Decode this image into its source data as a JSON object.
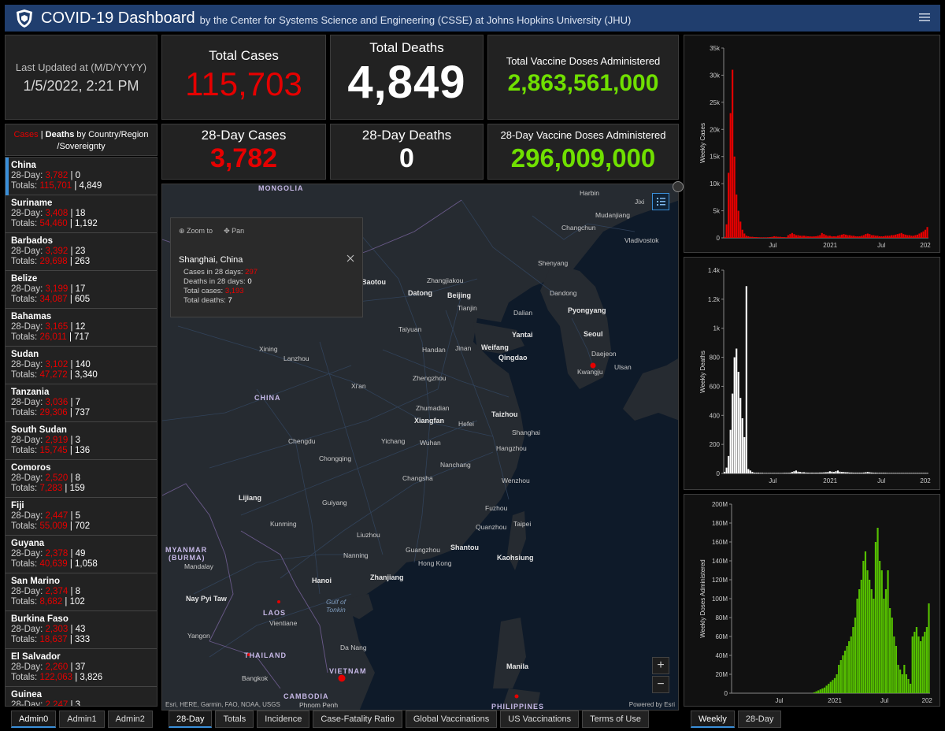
{
  "header": {
    "title": "COVID-19 Dashboard",
    "subtitle": "by the Center for Systems Science and Engineering (CSSE) at Johns Hopkins University (JHU)"
  },
  "updated": {
    "label": "Last Updated at (M/D/YYYY)",
    "value": "1/5/2022, 2:21 PM"
  },
  "stats": {
    "total_cases_label": "Total Cases",
    "total_cases": "115,703",
    "total_deaths_label": "Total Deaths",
    "total_deaths": "4,849",
    "total_vacc_label": "Total Vaccine Doses Administered",
    "total_vacc": "2,863,561,000",
    "cases28_label": "28-Day Cases",
    "cases28": "3,782",
    "deaths28_label": "28-Day Deaths",
    "deaths28": "0",
    "vacc28_label": "28-Day Vaccine Doses Administered",
    "vacc28": "296,009,000"
  },
  "list_header": {
    "cases": "Cases",
    "sep": " | ",
    "deaths": "Deaths",
    "rest": " by Country/Region /Sovereignty"
  },
  "countries": [
    {
      "name": "China",
      "d28c": "3,782",
      "d28d": "0",
      "tc": "115,701",
      "td": "4,849"
    },
    {
      "name": "Suriname",
      "d28c": "3,408",
      "d28d": "18",
      "tc": "54,460",
      "td": "1,192"
    },
    {
      "name": "Barbados",
      "d28c": "3,392",
      "d28d": "23",
      "tc": "29,698",
      "td": "263"
    },
    {
      "name": "Belize",
      "d28c": "3,199",
      "d28d": "17",
      "tc": "34,087",
      "td": "605"
    },
    {
      "name": "Bahamas",
      "d28c": "3,165",
      "d28d": "12",
      "tc": "26,011",
      "td": "717"
    },
    {
      "name": "Sudan",
      "d28c": "3,102",
      "d28d": "140",
      "tc": "47,272",
      "td": "3,340"
    },
    {
      "name": "Tanzania",
      "d28c": "3,036",
      "d28d": "7",
      "tc": "29,306",
      "td": "737"
    },
    {
      "name": "South Sudan",
      "d28c": "2,919",
      "d28d": "3",
      "tc": "15,745",
      "td": "136"
    },
    {
      "name": "Comoros",
      "d28c": "2,520",
      "d28d": "8",
      "tc": "7,283",
      "td": "159"
    },
    {
      "name": "Fiji",
      "d28c": "2,447",
      "d28d": "5",
      "tc": "55,009",
      "td": "702"
    },
    {
      "name": "Guyana",
      "d28c": "2,378",
      "d28d": "49",
      "tc": "40,639",
      "td": "1,058"
    },
    {
      "name": "San Marino",
      "d28c": "2,374",
      "d28d": "8",
      "tc": "8,682",
      "td": "102"
    },
    {
      "name": "Burkina Faso",
      "d28c": "2,303",
      "d28d": "43",
      "tc": "18,637",
      "td": "333"
    },
    {
      "name": "El Salvador",
      "d28c": "2,260",
      "d28d": "37",
      "tc": "122,063",
      "td": "3,826"
    },
    {
      "name": "Guinea",
      "d28c": "2,247",
      "d28d": "3",
      "tc": "",
      "td": ""
    }
  ],
  "list_labels": {
    "d28": "28-Day: ",
    "totals": "Totals: "
  },
  "popup": {
    "zoom": "Zoom to",
    "pan": "Pan",
    "title": "Shanghai, China",
    "cases28_label": "Cases in 28 days: ",
    "cases28": "297",
    "deaths28_label": "Deaths in 28 days: ",
    "deaths28": "0",
    "total_cases_label": "Total cases: ",
    "total_cases": "3,193",
    "total_deaths_label": "Total deaths: ",
    "total_deaths": "7"
  },
  "map": {
    "attribution": "Esri, HERE, Garmin, FAO, NOAA, USGS",
    "powered": "Powered by Esri",
    "countries": [
      {
        "t": "MONGOLIA"
      },
      {
        "t": "CHINA"
      },
      {
        "t": "MYANMAR"
      },
      {
        "t": "(BURMA)"
      },
      {
        "t": "LAOS"
      },
      {
        "t": "THAILAND"
      },
      {
        "t": "VIETNAM"
      },
      {
        "t": "CAMBODIA"
      },
      {
        "t": "PHILIPPINES"
      }
    ],
    "seas": [
      {
        "t": "Gulf of"
      },
      {
        "t": "Tonkin"
      }
    ],
    "cities": [
      {
        "t": "Harbin"
      },
      {
        "t": "Jixi"
      },
      {
        "t": "Mudanjiang"
      },
      {
        "t": "Changchun"
      },
      {
        "t": "Vladivostok"
      },
      {
        "t": "Shenyang"
      },
      {
        "t": "Baotou"
      },
      {
        "t": "Zhangjiakou"
      },
      {
        "t": "Datong"
      },
      {
        "t": "Beijing"
      },
      {
        "t": "Tianjin"
      },
      {
        "t": "Dandong"
      },
      {
        "t": "Pyongyang"
      },
      {
        "t": "Dalian"
      },
      {
        "t": "Taiyuan"
      },
      {
        "t": "Yantai"
      },
      {
        "t": "Seoul"
      },
      {
        "t": "Xining"
      },
      {
        "t": "Lanzhou"
      },
      {
        "t": "Handan"
      },
      {
        "t": "Jinan"
      },
      {
        "t": "Weifang"
      },
      {
        "t": "Qingdao"
      },
      {
        "t": "Daejeon"
      },
      {
        "t": "Ulsan"
      },
      {
        "t": "Kwangju"
      },
      {
        "t": "Xi'an"
      },
      {
        "t": "Zhengzhou"
      },
      {
        "t": "Zhumadian"
      },
      {
        "t": "Taizhou"
      },
      {
        "t": "Xiangfan"
      },
      {
        "t": "Hefei"
      },
      {
        "t": "Shanghai"
      },
      {
        "t": "Chengdu"
      },
      {
        "t": "Yichang"
      },
      {
        "t": "Wuhan"
      },
      {
        "t": "Hangzhou"
      },
      {
        "t": "Chongqing"
      },
      {
        "t": "Changsha"
      },
      {
        "t": "Nanchang"
      },
      {
        "t": "Wenzhou"
      },
      {
        "t": "Lijiang"
      },
      {
        "t": "Guiyang"
      },
      {
        "t": "Fuzhou"
      },
      {
        "t": "Kunming"
      },
      {
        "t": "Liuzhou"
      },
      {
        "t": "Quanzhou"
      },
      {
        "t": "Taipei"
      },
      {
        "t": "Mandalay"
      },
      {
        "t": "Nanning"
      },
      {
        "t": "Guangzhou"
      },
      {
        "t": "Shantou"
      },
      {
        "t": "Hong Kong"
      },
      {
        "t": "Kaohsiung"
      },
      {
        "t": "Hanoi"
      },
      {
        "t": "Zhanjiang"
      },
      {
        "t": "Nay Pyi Taw"
      },
      {
        "t": "Vientiane"
      },
      {
        "t": "Yangon"
      },
      {
        "t": "Da Nang"
      },
      {
        "t": "Manila"
      },
      {
        "t": "Bangkok"
      },
      {
        "t": "Phnom Penh"
      }
    ]
  },
  "charts": {
    "cases": {
      "ylabel": "Weekly Cases",
      "yticks": [
        "0",
        "5k",
        "10k",
        "15k",
        "20k",
        "25k",
        "30k",
        "35k"
      ],
      "xticks": [
        "Jul",
        "2021",
        "Jul",
        "202"
      ]
    },
    "deaths": {
      "ylabel": "Weekly Deaths",
      "yticks": [
        "0",
        "200",
        "400",
        "600",
        "800",
        "1k",
        "1.2k",
        "1.4k"
      ],
      "xticks": [
        "Jul",
        "2021",
        "Jul",
        "202"
      ]
    },
    "vacc": {
      "ylabel": "Weekly Doses Administered",
      "yticks": [
        "0",
        "20M",
        "40M",
        "60M",
        "80M",
        "100M",
        "120M",
        "140M",
        "160M",
        "180M",
        "200M"
      ],
      "xticks": [
        "Jul",
        "2021",
        "Jul",
        "202"
      ]
    }
  },
  "chart_data": [
    {
      "type": "bar",
      "ylabel": "Weekly Cases",
      "ylim": [
        0,
        35000
      ],
      "color": "#e60000",
      "values": [
        200,
        2500,
        12000,
        23000,
        31000,
        15000,
        8000,
        5000,
        3000,
        1500,
        800,
        400,
        300,
        200,
        200,
        150,
        150,
        120,
        100,
        100,
        100,
        100,
        120,
        150,
        200,
        300,
        250,
        200,
        200,
        150,
        150,
        120,
        500,
        700,
        900,
        700,
        500,
        500,
        400,
        400,
        400,
        350,
        300,
        300,
        250,
        300,
        300,
        400,
        500,
        900,
        700,
        500,
        400,
        400,
        300,
        300,
        300,
        400,
        500,
        600,
        700,
        600,
        500,
        500,
        400,
        400,
        300,
        300,
        300,
        400,
        500,
        700,
        800,
        700,
        500,
        500,
        400,
        400,
        300,
        300,
        300,
        400,
        400,
        400,
        500,
        500,
        600,
        700,
        800,
        900,
        700,
        600,
        500,
        500,
        400,
        400,
        500,
        600,
        800,
        1000,
        1200,
        1500,
        2000
      ]
    },
    {
      "type": "bar",
      "ylabel": "Weekly Deaths",
      "ylim": [
        0,
        1400
      ],
      "color": "#ffffff",
      "values": [
        10,
        40,
        120,
        300,
        550,
        800,
        860,
        700,
        520,
        380,
        250,
        1290,
        30,
        20,
        10,
        5,
        5,
        5,
        4,
        4,
        3,
        3,
        3,
        3,
        3,
        3,
        3,
        3,
        3,
        3,
        4,
        4,
        4,
        5,
        10,
        15,
        20,
        12,
        10,
        8,
        8,
        6,
        5,
        5,
        5,
        5,
        5,
        5,
        6,
        6,
        7,
        8,
        9,
        15,
        12,
        10,
        15,
        20,
        12,
        10,
        10,
        8,
        8,
        6,
        6,
        5,
        5,
        5,
        5,
        5,
        6,
        8,
        10,
        8,
        6,
        5,
        5,
        4,
        4,
        4,
        4,
        4,
        3,
        3,
        3,
        3,
        3,
        3,
        3,
        3,
        3,
        3,
        3,
        3,
        3,
        3,
        3,
        3,
        3,
        3,
        3,
        3,
        3
      ]
    },
    {
      "type": "bar",
      "ylabel": "Weekly Doses Administered",
      "ylim": [
        0,
        200000000
      ],
      "color": "#55c000",
      "values": [
        0,
        0,
        0,
        0,
        0,
        0,
        0,
        0,
        0,
        0,
        0,
        0,
        0,
        0,
        0,
        0,
        0,
        0,
        0,
        0,
        0,
        0,
        0,
        0,
        0,
        0,
        0,
        0,
        0,
        0,
        0,
        0,
        0,
        0,
        0,
        0,
        0,
        0,
        0,
        0,
        1000000,
        2000000,
        3000000,
        4000000,
        5000000,
        6000000,
        8000000,
        10000000,
        12000000,
        14000000,
        16000000,
        20000000,
        30000000,
        35000000,
        40000000,
        45000000,
        50000000,
        55000000,
        60000000,
        70000000,
        80000000,
        100000000,
        110000000,
        120000000,
        140000000,
        150000000,
        130000000,
        120000000,
        110000000,
        100000000,
        160000000,
        175000000,
        140000000,
        130000000,
        100000000,
        110000000,
        130000000,
        90000000,
        80000000,
        60000000,
        50000000,
        30000000,
        25000000,
        20000000,
        30000000,
        20000000,
        15000000,
        10000000,
        60000000,
        65000000,
        70000000,
        60000000,
        55000000,
        60000000,
        65000000,
        70000000,
        95000000
      ]
    }
  ],
  "tabs_left": [
    "Admin0",
    "Admin1",
    "Admin2"
  ],
  "tabs_mid": [
    "28-Day",
    "Totals",
    "Incidence",
    "Case-Fatality Ratio",
    "Global Vaccinations",
    "US Vaccinations",
    "Terms of Use"
  ],
  "tabs_right": [
    "Weekly",
    "28-Day"
  ]
}
